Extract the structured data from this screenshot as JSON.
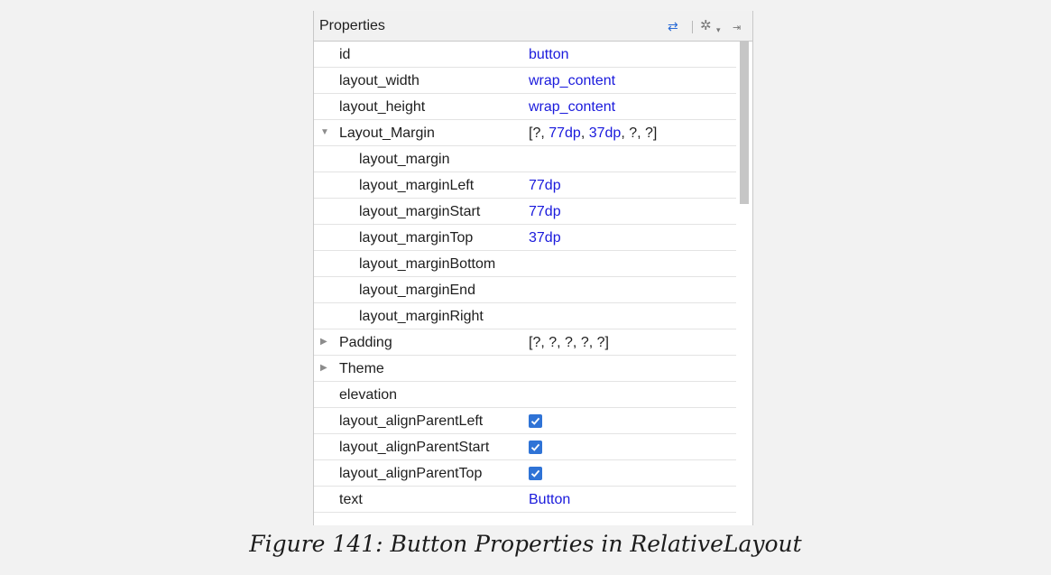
{
  "panel": {
    "title": "Properties",
    "icons": [
      "swap-arrows-icon",
      "gear-icon",
      "chevron-down-icon",
      "pin-icon"
    ]
  },
  "rows": [
    {
      "name": "id",
      "value": "button"
    },
    {
      "name": "layout_width",
      "value": "wrap_content"
    },
    {
      "name": "layout_height",
      "value": "wrap_content"
    },
    {
      "name": "Layout_Margin",
      "value_parts": [
        "[?, ",
        "77dp",
        ", ",
        "37dp",
        ", ?, ?]"
      ],
      "expanded": true
    },
    {
      "name": "layout_margin",
      "value": ""
    },
    {
      "name": "layout_marginLeft",
      "value": "77dp"
    },
    {
      "name": "layout_marginStart",
      "value": "77dp"
    },
    {
      "name": "layout_marginTop",
      "value": "37dp"
    },
    {
      "name": "layout_marginBottom",
      "value": ""
    },
    {
      "name": "layout_marginEnd",
      "value": ""
    },
    {
      "name": "layout_marginRight",
      "value": ""
    },
    {
      "name": "Padding",
      "value": "[?, ?, ?, ?, ?]",
      "expanded": false
    },
    {
      "name": "Theme",
      "value": "",
      "expanded": false
    },
    {
      "name": "elevation",
      "value": ""
    },
    {
      "name": "layout_alignParentLeft",
      "checked": true
    },
    {
      "name": "layout_alignParentStart",
      "checked": true
    },
    {
      "name": "layout_alignParentTop",
      "checked": true
    },
    {
      "name": "text",
      "value": "Button"
    }
  ],
  "colors": {
    "accent": "#2f73d6",
    "value_text": "#1a1adc"
  },
  "caption": "Figure 141: Button Properties in RelativeLayout"
}
